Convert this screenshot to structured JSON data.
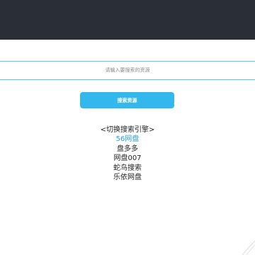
{
  "header": {
    "background_color": "#2a2f37"
  },
  "search": {
    "placeholder": "请输入要搜索的资源",
    "button_label": "搜索资源",
    "accent_color": "#33b8ee"
  },
  "engines": {
    "header": "<切换搜索引擎>",
    "items": [
      {
        "label": "56网盘",
        "active": true
      },
      {
        "label": "盘多多",
        "active": false
      },
      {
        "label": "网盘007",
        "active": false
      },
      {
        "label": "蛇鸟搜索",
        "active": false
      },
      {
        "label": "乐依网盘",
        "active": false
      }
    ],
    "active_color": "#2a9fe0"
  }
}
